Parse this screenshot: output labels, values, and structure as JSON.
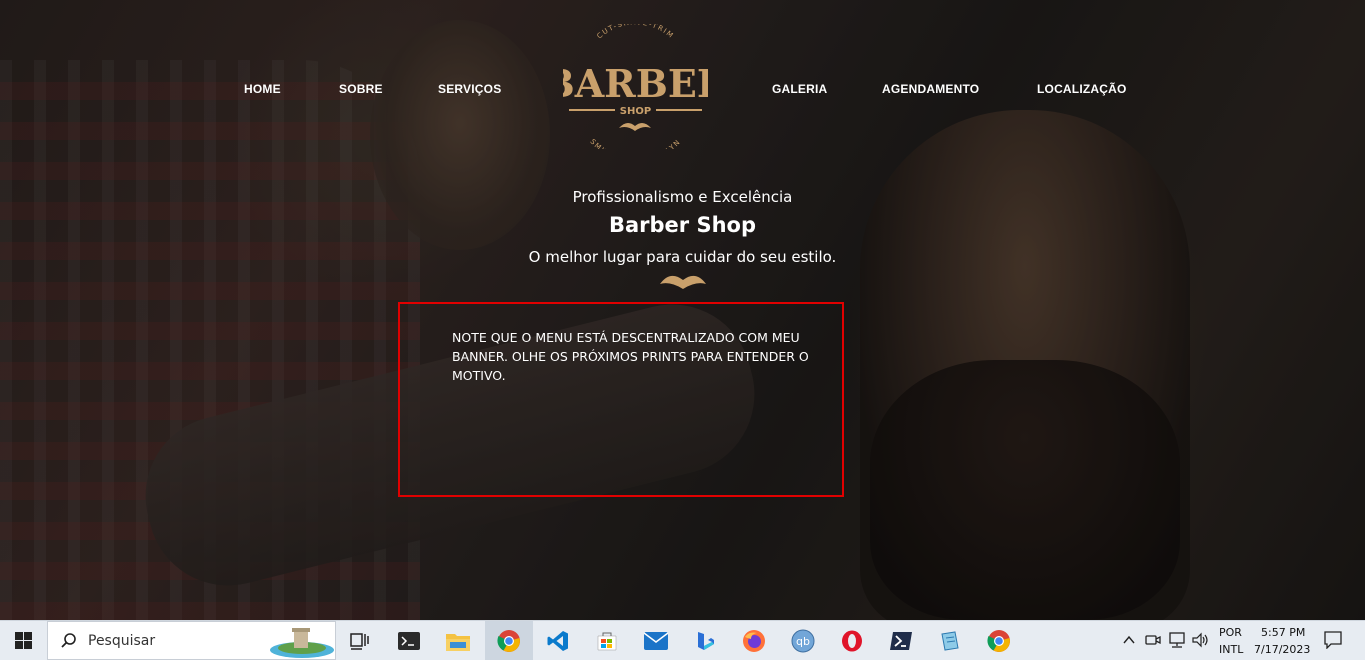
{
  "nav": {
    "left": [
      "HOME",
      "SOBRE",
      "SERVIÇOS"
    ],
    "right": [
      "GALERIA",
      "AGENDAMENTO",
      "LOCALIZAÇÃO"
    ]
  },
  "logo": {
    "top_arc": "CUT-SHAVE-TRIM",
    "main": "BARBER",
    "sub": "SHOP",
    "bottom_arc": "SMITH ST. BROOKLYN"
  },
  "hero": {
    "line1": "Profissionalismo e Excelência",
    "line2": "Barber Shop",
    "line3": "O melhor lugar para cuidar do seu estilo."
  },
  "note": {
    "text": "NOTE QUE O MENU ESTÁ DESCENTRALIZADO COM MEU BANNER. OLHE OS PRÓXIMOS PRINTS PARA ENTENDER O MOTIVO."
  },
  "taskbar": {
    "search_placeholder": "Pesquisar",
    "apps": [
      "task-view",
      "terminal",
      "file-explorer",
      "chrome",
      "vscode",
      "microsoft-store",
      "mail",
      "copilot",
      "firefox",
      "qbittorrent",
      "opera",
      "powershell",
      "notepad",
      "chrome"
    ],
    "qb_label": "qb",
    "lang_top": "POR",
    "lang_bottom": "INTL",
    "time": "5:57 PM",
    "date": "7/17/2023"
  },
  "colors": {
    "logo_gold": "#c9a06b",
    "note_border": "#e10000",
    "taskbar_bg": "#e7ecf2"
  }
}
